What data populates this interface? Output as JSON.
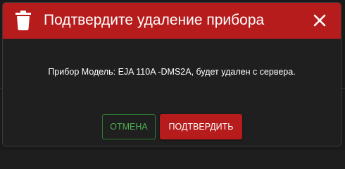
{
  "dialog": {
    "title": "Подтвердите удаление прибора",
    "message": "Прибор Модель: EJA 110A -DMS2A, будет удален с сервера.",
    "header_icon": "trash-icon",
    "close_icon": "close-icon",
    "cancel_label": "ОТМЕНА",
    "confirm_label": "ПОДТВЕРДИТЬ"
  },
  "colors": {
    "header_bg": "#b71c1c",
    "dialog_bg": "#1f1f1f",
    "cancel_text": "#4caf50",
    "confirm_bg": "#b71c1c"
  }
}
